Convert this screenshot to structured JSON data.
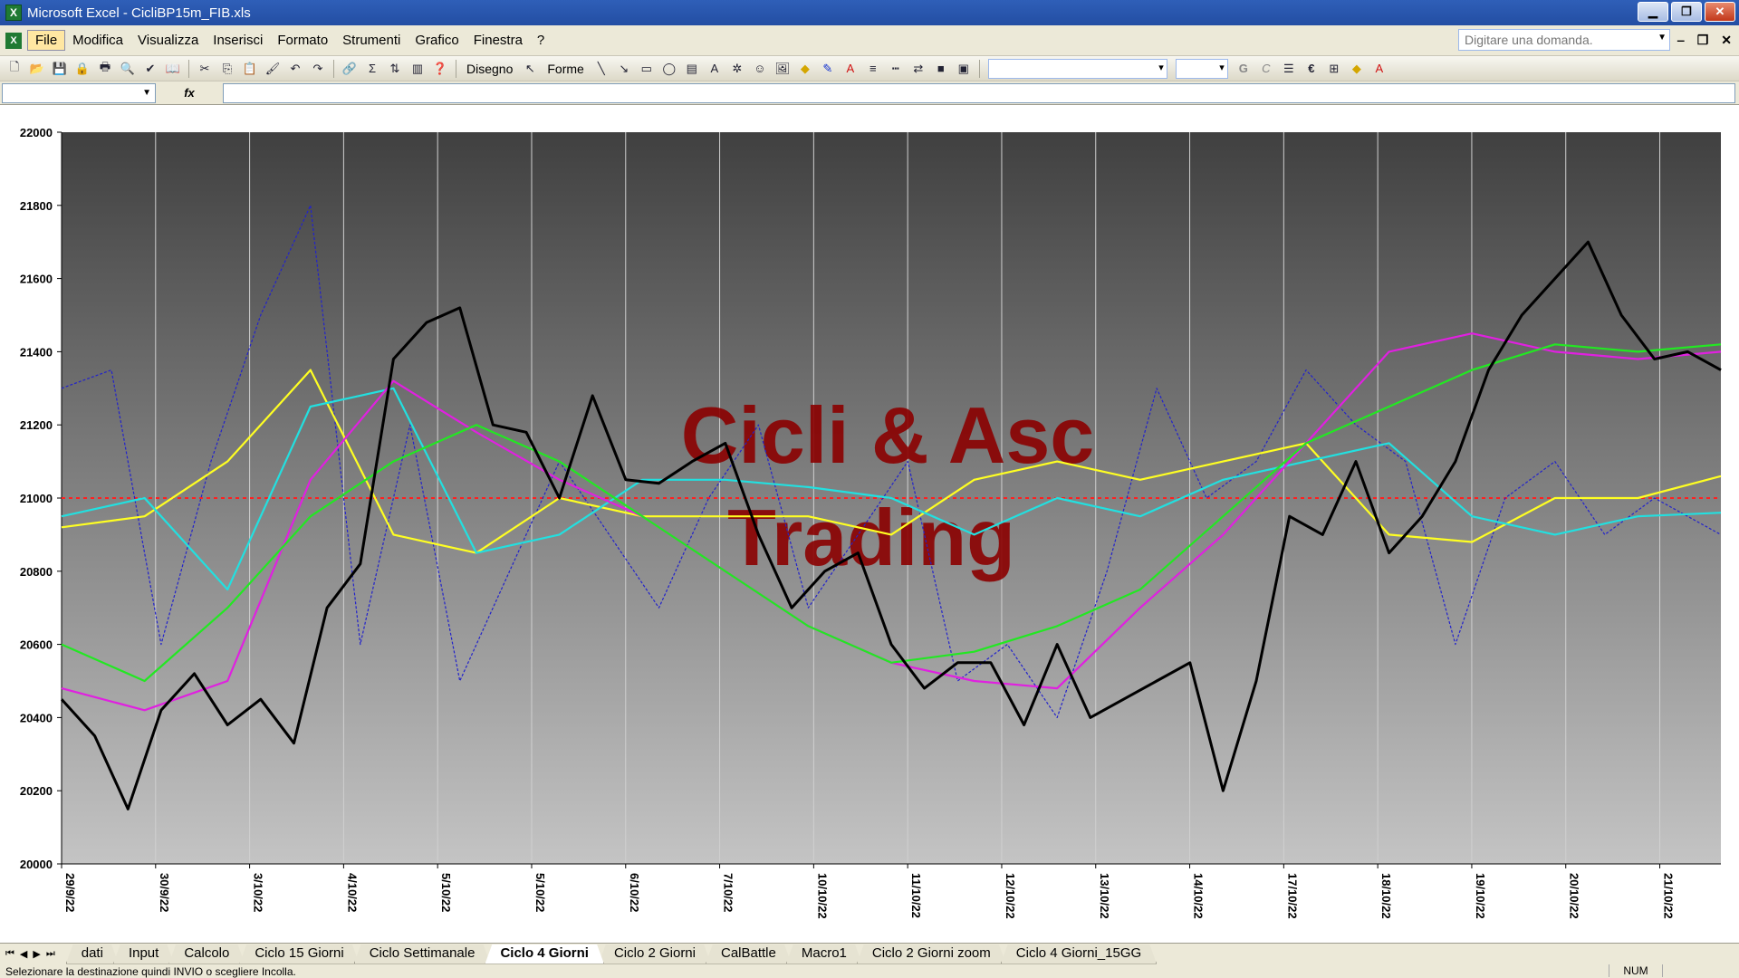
{
  "window": {
    "title": "Microsoft Excel - CicliBP15m_FIB.xls",
    "app_icon": "excel-icon",
    "minimize_glyph": "▁",
    "maximize_glyph": "❐",
    "close_glyph": "✕"
  },
  "menu": {
    "items": [
      "File",
      "Modifica",
      "Visualizza",
      "Inserisci",
      "Formato",
      "Strumenti",
      "Grafico",
      "Finestra",
      "?"
    ],
    "active_index": 0,
    "help_placeholder": "Digitare una domanda.",
    "doc_minimize_glyph": "‒",
    "doc_restore_glyph": "❐",
    "doc_close_glyph": "✕"
  },
  "toolbar": {
    "disegno_label": "Disegno",
    "forme_label": "Forme"
  },
  "formula_bar": {
    "fx_label": "fx",
    "name_box_value": "",
    "formula_value": ""
  },
  "chart_data": {
    "type": "line",
    "title": "",
    "watermark": [
      "Cicli & Asc",
      "Trading"
    ],
    "xlabel": "",
    "ylabel": "",
    "ylim": [
      20000,
      22000
    ],
    "yticks": [
      20000,
      20200,
      20400,
      20600,
      20800,
      21000,
      21200,
      21400,
      21600,
      21800,
      22000
    ],
    "date_labels": [
      "29/9/22",
      "30/9/22",
      "3/10/22",
      "4/10/22",
      "5/10/22",
      "5/10/22",
      "6/10/22",
      "7/10/22",
      "10/10/22",
      "11/10/22",
      "12/10/22",
      "13/10/22",
      "14/10/22",
      "17/10/22",
      "18/10/22",
      "19/10/22",
      "20/10/22",
      "21/10/22"
    ],
    "reference_line": 21000,
    "grid": true,
    "x_range": [
      0,
      100
    ],
    "colors": {
      "price": "#000000",
      "green": "#22e822",
      "magenta": "#e020e0",
      "cyan": "#22e0e0",
      "yellow": "#ffff22",
      "blue_dotted": "#2222cc",
      "reference": "#ff2020",
      "watermark": "#8b0000"
    },
    "series": [
      {
        "key": "price",
        "x": [
          0,
          2,
          4,
          6,
          8,
          10,
          12,
          14,
          16,
          18,
          20,
          22,
          24,
          26,
          28,
          30,
          32,
          34,
          36,
          38,
          40,
          42,
          44,
          46,
          48,
          50,
          52,
          54,
          56,
          58,
          60,
          62,
          64,
          66,
          68,
          70,
          72,
          74,
          76,
          78,
          80,
          82,
          84,
          86,
          88,
          90,
          92,
          94,
          96,
          98,
          100
        ],
        "values": [
          20450,
          20350,
          20150,
          20420,
          20520,
          20380,
          20450,
          20330,
          20700,
          20820,
          21380,
          21480,
          21520,
          21200,
          21180,
          21000,
          21280,
          21050,
          21040,
          21100,
          21150,
          20900,
          20700,
          20800,
          20850,
          20600,
          20480,
          20550,
          20550,
          20380,
          20600,
          20400,
          20450,
          20500,
          20550,
          20200,
          20500,
          20950,
          20900,
          21100,
          20850,
          20950,
          21100,
          21350,
          21500,
          21600,
          21700,
          21500,
          21380,
          21400,
          21350
        ]
      },
      {
        "key": "green",
        "x": [
          0,
          5,
          10,
          15,
          20,
          25,
          30,
          35,
          40,
          45,
          50,
          55,
          60,
          65,
          70,
          75,
          80,
          85,
          90,
          95,
          100
        ],
        "values": [
          20600,
          20500,
          20700,
          20950,
          21100,
          21200,
          21100,
          20950,
          20800,
          20650,
          20550,
          20580,
          20650,
          20750,
          20950,
          21150,
          21250,
          21350,
          21420,
          21400,
          21420
        ]
      },
      {
        "key": "magenta",
        "x": [
          0,
          5,
          10,
          15,
          20,
          25,
          30,
          35,
          40,
          45,
          50,
          55,
          60,
          65,
          70,
          75,
          80,
          85,
          90,
          95,
          100
        ],
        "values": [
          20480,
          20420,
          20500,
          21050,
          21320,
          21180,
          21050,
          20950,
          20800,
          20650,
          20550,
          20500,
          20480,
          20700,
          20900,
          21150,
          21400,
          21450,
          21400,
          21380,
          21400
        ]
      },
      {
        "key": "cyan",
        "x": [
          0,
          5,
          10,
          15,
          20,
          25,
          30,
          35,
          40,
          45,
          50,
          55,
          60,
          65,
          70,
          75,
          80,
          85,
          90,
          95,
          100
        ],
        "values": [
          20950,
          21000,
          20750,
          21250,
          21300,
          20850,
          20900,
          21050,
          21050,
          21030,
          21000,
          20900,
          21000,
          20950,
          21050,
          21100,
          21150,
          20950,
          20900,
          20950,
          20960
        ]
      },
      {
        "key": "yellow",
        "x": [
          0,
          5,
          10,
          15,
          20,
          25,
          30,
          35,
          40,
          45,
          50,
          55,
          60,
          65,
          70,
          75,
          80,
          85,
          90,
          95,
          100
        ],
        "values": [
          20920,
          20950,
          21100,
          21350,
          20900,
          20850,
          21000,
          20950,
          20950,
          20950,
          20900,
          21050,
          21100,
          21050,
          21100,
          21150,
          20900,
          20880,
          21000,
          21000,
          21060
        ]
      },
      {
        "key": "blue_dotted",
        "x": [
          0,
          3,
          6,
          9,
          12,
          15,
          18,
          21,
          24,
          27,
          30,
          33,
          36,
          39,
          42,
          45,
          48,
          51,
          54,
          57,
          60,
          63,
          66,
          69,
          72,
          75,
          78,
          81,
          84,
          87,
          90,
          93,
          96,
          100
        ],
        "values": [
          21300,
          21350,
          20600,
          21100,
          21500,
          21800,
          20600,
          21200,
          20500,
          20800,
          21100,
          20900,
          20700,
          21000,
          21200,
          20700,
          20900,
          21100,
          20500,
          20600,
          20400,
          20800,
          21300,
          21000,
          21100,
          21350,
          21200,
          21100,
          20600,
          21000,
          21100,
          20900,
          21000,
          20900
        ]
      }
    ]
  },
  "sheet_tabs": {
    "items": [
      "dati",
      "Input",
      "Calcolo",
      "Ciclo 15 Giorni",
      "Ciclo Settimanale",
      "Ciclo 4 Giorni",
      "Ciclo 2 Giorni",
      "CalBattle",
      "Macro1",
      "Ciclo 2 Giorni zoom",
      "Ciclo 4 Giorni_15GG"
    ],
    "active_index": 5,
    "nav": [
      "⏮",
      "◀",
      "▶",
      "⏭"
    ]
  },
  "status": {
    "message": "Selezionare la destinazione quindi INVIO o scegliere Incolla.",
    "num_indicator": "NUM"
  }
}
